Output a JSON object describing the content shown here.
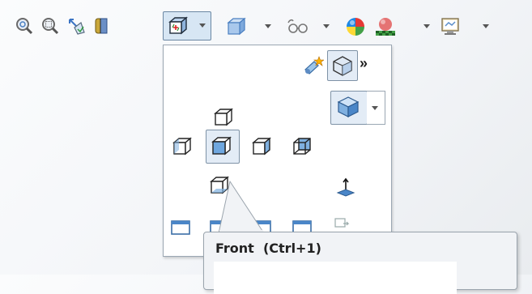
{
  "toolbar": {
    "buttons": [
      {
        "name": "zoom-to-fit",
        "icon": "magnifier-zoom-fit-icon"
      },
      {
        "name": "zoom-to-area",
        "icon": "magnifier-zoom-area-icon"
      },
      {
        "name": "previous-view",
        "icon": "previous-view-icon"
      },
      {
        "name": "section-view",
        "icon": "section-view-icon"
      },
      {
        "name": "view-orientation",
        "icon": "view-orientation-cube-icon",
        "active": true
      },
      {
        "name": "display-style",
        "icon": "display-style-cube-icon"
      },
      {
        "name": "hide-show-items",
        "icon": "eyeglasses-icon"
      },
      {
        "name": "edit-appearance",
        "icon": "color-ball-icon"
      },
      {
        "name": "apply-scene",
        "icon": "scene-icon"
      },
      {
        "name": "view-settings",
        "icon": "monitor-settings-icon"
      }
    ]
  },
  "flyout": {
    "more_label": "»",
    "views": [
      "Top",
      "Left",
      "Front",
      "Right",
      "Back",
      "Bottom",
      "Isometric",
      "Normal To"
    ],
    "selected_view": "Front"
  },
  "tooltip": {
    "title": "Front  (Ctrl+1)"
  },
  "colors": {
    "accent": "#4a90d9",
    "selection": "#e3ecf6",
    "tooltip_bg": "#f1f3f6"
  }
}
